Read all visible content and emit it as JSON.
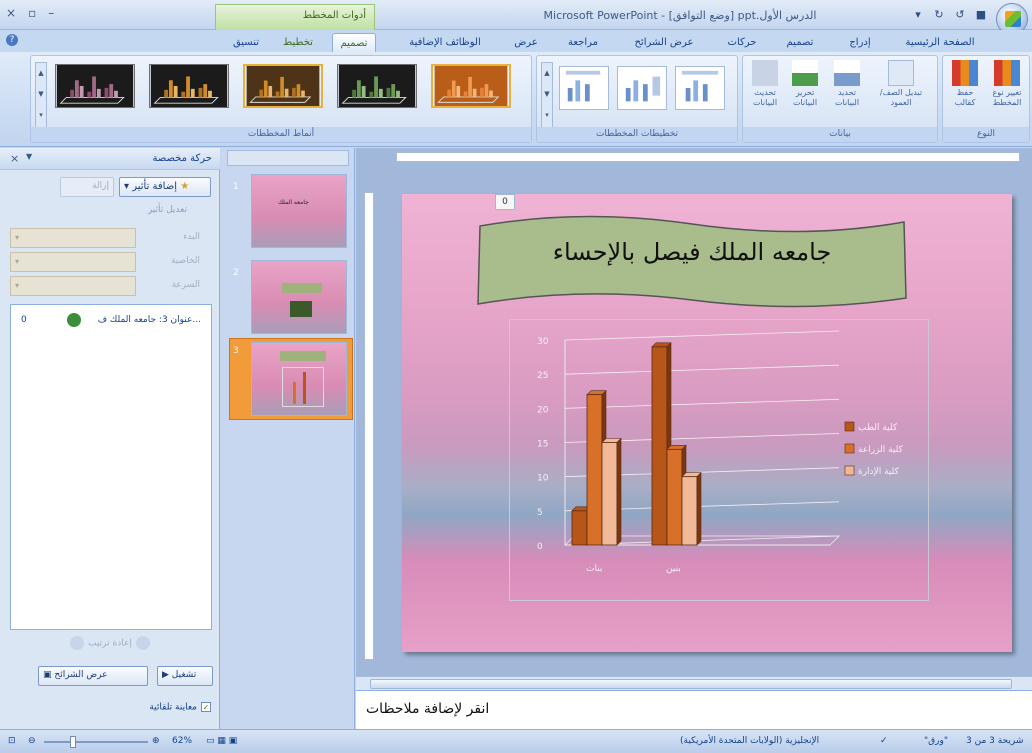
{
  "window": {
    "title": "Microsoft PowerPoint - [وضع التوافق] ppt.الدرس الأول",
    "contextual_group": "أدوات المخطط",
    "minimize": "–",
    "maximize": "▫",
    "close": "×"
  },
  "qat": [
    "save-icon",
    "undo-icon",
    "redo-icon",
    "customize-icon"
  ],
  "tabs": [
    {
      "label": "الصفحة الرئيسية"
    },
    {
      "label": "إدراج"
    },
    {
      "label": "تصميم"
    },
    {
      "label": "حركات"
    },
    {
      "label": "عرض الشرائح"
    },
    {
      "label": "مراجعة"
    },
    {
      "label": "عرض"
    },
    {
      "label": "الوظائف الإضافية"
    },
    {
      "label": "تصميم"
    },
    {
      "label": "تخطيط"
    },
    {
      "label": "تنسيق"
    }
  ],
  "ribbon": {
    "groups": {
      "type": "النوع",
      "data": "بيانات",
      "layouts": "تخطيطات المخططات",
      "styles": "أنماط المخططات"
    },
    "buttons": {
      "change_type": "تغيير نوع المخطط",
      "save_template": "حفظ كقالب",
      "switch_rowcol": "تبديل الصف/العمود",
      "select_data": "تحديد البيانات",
      "edit_data": "تحرير البيانات",
      "refresh_data": "تحديث البيانات"
    },
    "style_colors": [
      "#1b1b1b",
      "#1b1b1b",
      "#5a3a1a",
      "#1b1b1b",
      "#b85e18"
    ]
  },
  "anim_pane": {
    "title": "حركة مخصصة",
    "add_effect": "إضافة تأثير",
    "remove": "إزالة",
    "modify_label": "تعديل تأثير",
    "props": [
      {
        "label": "البدء",
        "value": ""
      },
      {
        "label": "الخاصية",
        "value": ""
      },
      {
        "label": "السرعة",
        "value": ""
      }
    ],
    "effect_item": {
      "number": "0",
      "text": "عنوان 3: جامعه الملك ف..."
    },
    "reorder": "إعادة ترتيب",
    "play": "تشغيل",
    "slideshow": "عرض الشرائح",
    "autopreview": "معاينة تلقائية"
  },
  "slides_pane": {
    "numbers": [
      "1",
      "2",
      "3"
    ],
    "thumb1_title": "جامعه الملك"
  },
  "slide": {
    "badge": "0",
    "title": "جامعه الملك فيصل بالإحساء"
  },
  "notes": {
    "placeholder": "انقر لإضافة ملاحظات"
  },
  "status": {
    "slide_info": "شريحة 3 من 3",
    "theme": "\"ورق\"",
    "language": "الإنجليزية (الولايات المتحدة الأمريكية)",
    "zoom": "62%"
  },
  "chart_data": {
    "type": "bar",
    "categories": [
      "بنات",
      "بنين"
    ],
    "series": [
      {
        "name": "كلية الطب",
        "color": "#b8561a",
        "values": [
          5,
          29
        ]
      },
      {
        "name": "كلية الزراعة",
        "color": "#d9702a",
        "values": [
          22,
          14
        ]
      },
      {
        "name": "كلية الإدارة",
        "color": "#f1b998",
        "values": [
          15,
          10
        ]
      }
    ],
    "yticks": [
      "0",
      "5",
      "10",
      "15",
      "20",
      "25",
      "30"
    ],
    "ylim": [
      0,
      30
    ],
    "legend_position": "right"
  }
}
